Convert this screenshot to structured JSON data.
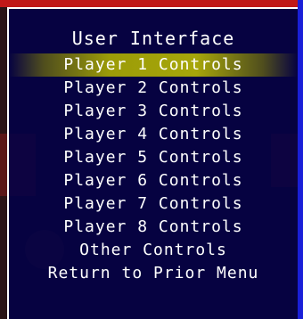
{
  "menu": {
    "title": "User Interface",
    "selected_index": 0,
    "items": [
      {
        "label": "Player 1 Controls"
      },
      {
        "label": "Player 2 Controls"
      },
      {
        "label": "Player 3 Controls"
      },
      {
        "label": "Player 4 Controls"
      },
      {
        "label": "Player 5 Controls"
      },
      {
        "label": "Player 6 Controls"
      },
      {
        "label": "Player 7 Controls"
      },
      {
        "label": "Player 8 Controls"
      },
      {
        "label": "Other Controls"
      },
      {
        "label": "Return to Prior Menu"
      }
    ]
  },
  "colors": {
    "panel_background": "#000048",
    "highlight": "#a6a60a",
    "text": "#ffffff",
    "border": "#ffffff"
  }
}
